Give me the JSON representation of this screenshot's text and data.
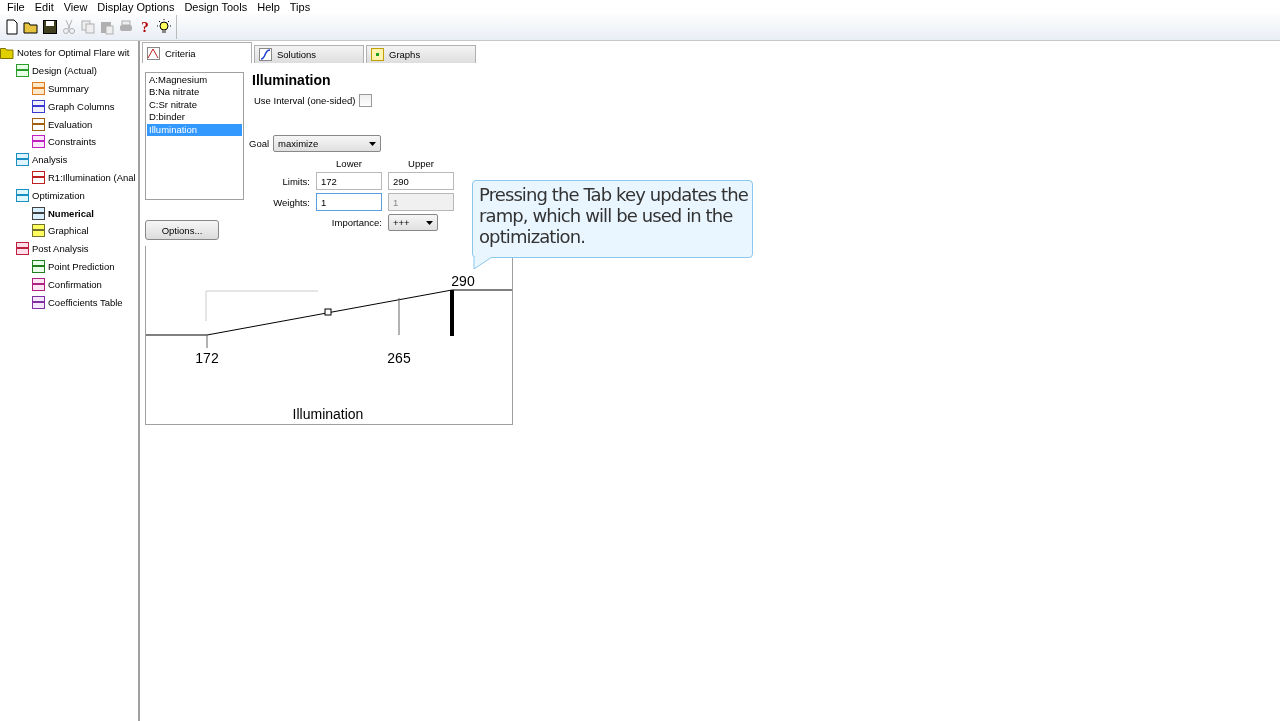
{
  "menu": [
    "File",
    "Edit",
    "View",
    "Display Options",
    "Design Tools",
    "Help",
    "Tips"
  ],
  "toolbar": [
    {
      "kind": "new",
      "disabled": false
    },
    {
      "kind": "open",
      "disabled": false
    },
    {
      "kind": "save",
      "disabled": false
    },
    {
      "kind": "cut",
      "disabled": true
    },
    {
      "kind": "copy",
      "disabled": true
    },
    {
      "kind": "paste",
      "disabled": true
    },
    {
      "kind": "print",
      "disabled": true
    },
    {
      "kind": "help",
      "label": "?"
    },
    {
      "kind": "tip"
    }
  ],
  "tree": {
    "label": "Notes for Optimal Flare wit",
    "children": [
      {
        "label": "Design (Actual)",
        "kind": "grid",
        "selected": false,
        "children": [
          {
            "label": "Summary",
            "kind": "sheet",
            "selected": false
          },
          {
            "label": "Graph Columns",
            "kind": "scatter",
            "selected": false
          },
          {
            "label": "Evaluation",
            "kind": "magnifier",
            "selected": false
          },
          {
            "label": "Constraints",
            "kind": "constraint",
            "selected": false
          }
        ]
      },
      {
        "label": "Analysis",
        "kind": "table",
        "selected": false,
        "children": [
          {
            "label": "R1:Illumination (Anal",
            "kind": "thermo",
            "selected": false
          }
        ]
      },
      {
        "label": "Optimization",
        "kind": "mountain",
        "selected": false,
        "children": [
          {
            "label": "Numerical",
            "kind": "funnel",
            "selected": true
          },
          {
            "label": "Graphical",
            "kind": "star",
            "selected": false
          }
        ]
      },
      {
        "label": "Post Analysis",
        "kind": "check",
        "selected": false,
        "children": [
          {
            "label": "Point Prediction",
            "kind": "bars",
            "selected": false
          },
          {
            "label": "Confirmation",
            "kind": "confirm",
            "selected": false
          },
          {
            "label": "Coefficients Table",
            "kind": "chartdoc",
            "selected": false
          }
        ]
      }
    ]
  },
  "tabs": [
    {
      "label": "Criteria",
      "kind": "peak",
      "selected": true
    },
    {
      "label": "Solutions",
      "kind": "curve",
      "selected": false
    },
    {
      "label": "Graphs",
      "kind": "plot",
      "selected": false
    }
  ],
  "criteria_list": [
    {
      "label": "A:Magnesium",
      "selected": false
    },
    {
      "label": "B:Na nitrate",
      "selected": false
    },
    {
      "label": "C:Sr nitrate",
      "selected": false
    },
    {
      "label": "D:binder",
      "selected": false
    },
    {
      "label": "Illumination",
      "selected": true
    }
  ],
  "options_button": "Options...",
  "criterion": {
    "title": "Illumination",
    "use_interval": {
      "label": "Use Interval (one-sided)",
      "checked": false
    },
    "goal": {
      "label": "Goal",
      "value": "maximize"
    },
    "column_headers": [
      "Lower",
      "Upper"
    ],
    "limits": {
      "label": "Limits:",
      "lower": "172",
      "upper": "290"
    },
    "weights": {
      "label": "Weights:",
      "lower": "1",
      "upper": "1",
      "upper_disabled": true
    },
    "importance": {
      "label": "Importance:",
      "value": "+++"
    }
  },
  "ramp": {
    "low_label": "172",
    "mid_label": "265",
    "high_label": "290",
    "axis_title": "Illumination"
  },
  "callout": "Pressing the Tab key updates the ramp, which will be used in the optimization."
}
